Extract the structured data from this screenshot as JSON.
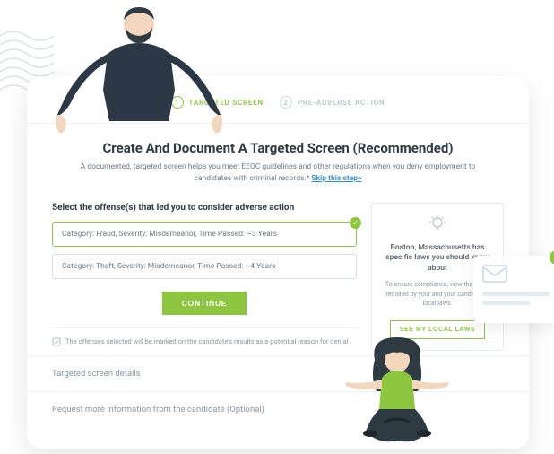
{
  "stepper": {
    "step1": {
      "num": "1",
      "label": "TARGETED SCREEN"
    },
    "step2": {
      "num": "2",
      "label": "PRE-ADVERSE ACTION"
    }
  },
  "header": {
    "title": "Create And Document A Targeted Screen (Recommended)",
    "subtitle_prefix": "A documented, targeted screen helps you meet EEOC guidelines and other regulations when you deny employment to candidates with criminal records.* ",
    "skip_label": "Skip this step>"
  },
  "offense_section": {
    "prompt": "Select the offense(s) that led you to consider adverse action",
    "items": [
      "Category: Fraud,  Severity: Misdemeanor,  Time Passed: ~3 Years",
      "Category: Theft,  Severity: Misdemeanor,  Time Passed: ~4 Years"
    ],
    "continue_label": "CONTINUE",
    "note": "The offenses selected will be marked on the candidate's results as a potential reason for denial"
  },
  "sections": {
    "details": "Targeted screen details",
    "request": "Request more information from the candidate (Optional)"
  },
  "laws_panel": {
    "title": "Boston, Massachusetts has specific laws you should know about",
    "body": "To ensure compliance, view the steps required by your and your candidate's local laws.",
    "button": "SEE MY LOCAL LAWS"
  }
}
